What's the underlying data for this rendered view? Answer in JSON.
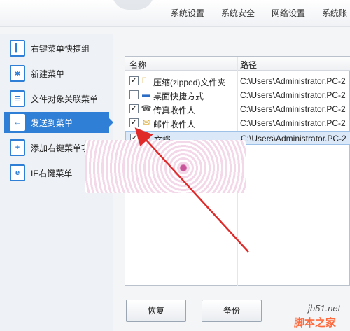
{
  "top_tabs": [
    "系统设置",
    "系统安全",
    "网络设置",
    "系统账"
  ],
  "sidebar": {
    "items": [
      {
        "label": "右键菜单快捷组",
        "icon": "menu-group-icon",
        "glyph": "▌"
      },
      {
        "label": "新建菜单",
        "icon": "new-menu-icon",
        "glyph": "✱"
      },
      {
        "label": "文件对象关联菜单",
        "icon": "file-assoc-icon",
        "glyph": "☰"
      },
      {
        "label": "发送到菜单",
        "icon": "send-to-icon",
        "glyph": "←",
        "active": true
      },
      {
        "label": "添加右键菜单项目",
        "icon": "add-item-icon",
        "glyph": "+"
      },
      {
        "label": "IE右键菜单",
        "icon": "ie-icon",
        "glyph": "e"
      }
    ]
  },
  "table": {
    "columns": [
      "名称",
      "路径"
    ],
    "rows": [
      {
        "checked": true,
        "name": "压缩(zipped)文件夹",
        "path": "C:\\Users\\Administrator.PC-2",
        "icon": "zip-folder-icon",
        "glyph": "🗀"
      },
      {
        "checked": false,
        "name": "桌面快捷方式",
        "path": "C:\\Users\\Administrator.PC-2",
        "icon": "desktop-shortcut-icon",
        "glyph": "▬"
      },
      {
        "checked": true,
        "name": "传真收件人",
        "path": "C:\\Users\\Administrator.PC-2",
        "icon": "fax-icon",
        "glyph": "☎"
      },
      {
        "checked": true,
        "name": "邮件收件人",
        "path": "C:\\Users\\Administrator.PC-2",
        "icon": "mail-icon",
        "glyph": "✉"
      },
      {
        "checked": true,
        "name": "文档",
        "path": "C:\\Users\\Administrator.PC-2",
        "icon": "document-icon",
        "glyph": "🗋",
        "selected": true
      }
    ]
  },
  "buttons": {
    "restore": "恢复",
    "backup": "备份"
  },
  "watermark": {
    "site": "jb51.net",
    "name": "脚本之家"
  }
}
